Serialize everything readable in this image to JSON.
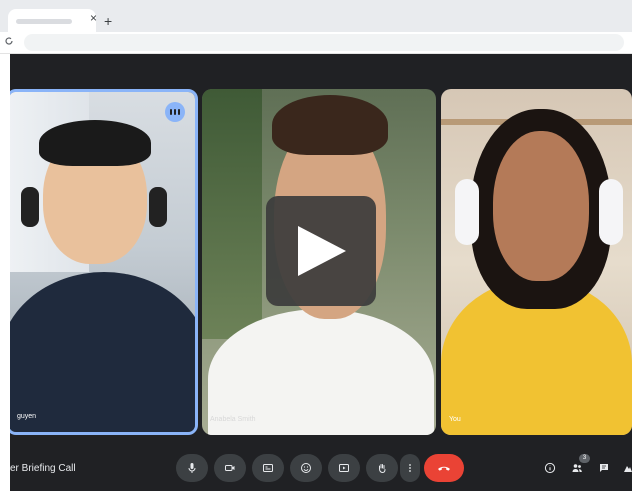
{
  "browser": {
    "tab_close": "×",
    "new_tab": "+",
    "reload_icon": "reload-icon"
  },
  "meeting": {
    "title": "er Briefing Call",
    "participants": [
      {
        "name": "guyen",
        "speaking": true
      },
      {
        "name": "Anabela Smith",
        "speaking": false
      },
      {
        "name": "You",
        "speaking": false
      }
    ],
    "participant_count_badge": "3"
  },
  "controls": [
    {
      "name": "mic-button",
      "icon": "mic-icon"
    },
    {
      "name": "camera-button",
      "icon": "camera-icon"
    },
    {
      "name": "captions-button",
      "icon": "captions-icon"
    },
    {
      "name": "emoji-button",
      "icon": "emoji-icon"
    },
    {
      "name": "present-button",
      "icon": "present-icon"
    },
    {
      "name": "raise-hand-button",
      "icon": "hand-icon"
    },
    {
      "name": "more-options-button",
      "icon": "more-vert-icon"
    },
    {
      "name": "end-call-button",
      "icon": "end-call-icon"
    }
  ],
  "right_controls": [
    {
      "name": "info-button",
      "icon": "info-icon"
    },
    {
      "name": "people-button",
      "icon": "people-icon"
    },
    {
      "name": "chat-button",
      "icon": "chat-icon"
    },
    {
      "name": "activities-button",
      "icon": "activities-icon"
    }
  ],
  "colors": {
    "meet_bg": "#202124",
    "active_speaker_border": "#8ab4f8",
    "end_call": "#ea4335",
    "control_bg": "#3c4043"
  },
  "overlay": {
    "icon": "play-icon"
  }
}
